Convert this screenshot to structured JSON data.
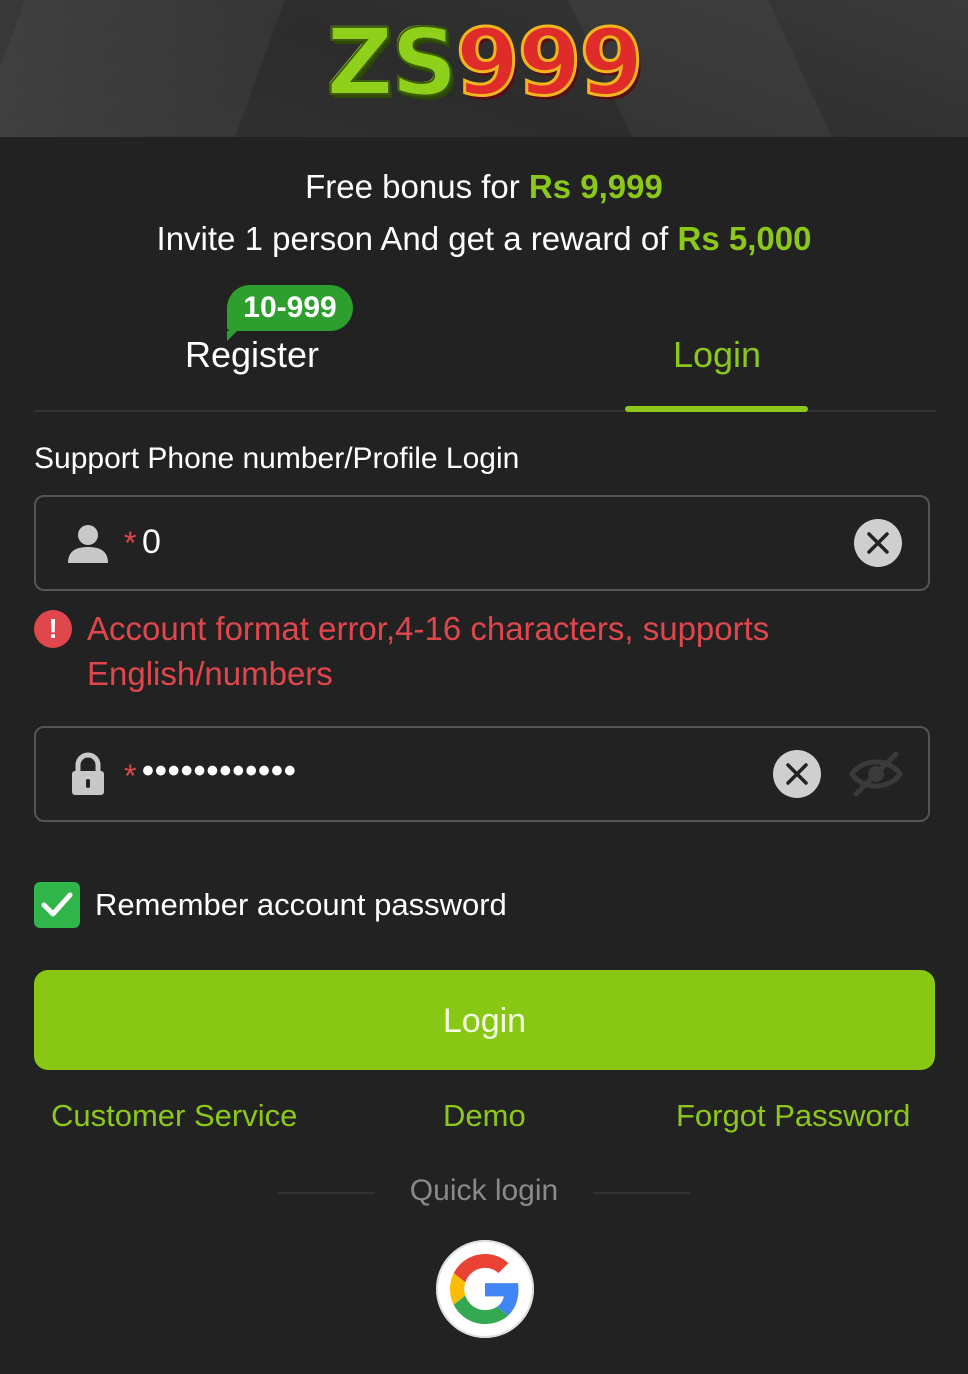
{
  "header": {
    "logo_part1": "ZS",
    "logo_part2": "999"
  },
  "promo": {
    "line1_prefix": "Free bonus for ",
    "line1_amount": "Rs 9,999",
    "line2_prefix": "Invite 1 person And get a reward of ",
    "line2_amount": "Rs 5,000"
  },
  "tabs": {
    "register_label": "Register",
    "register_badge": "10-999",
    "login_label": "Login",
    "active": "login"
  },
  "form": {
    "account_label": "Support Phone number/Profile Login",
    "account_required_mark": "*",
    "account_value": "0",
    "error_icon": "!",
    "error_message": "Account format error,4-16 characters, supports English/numbers",
    "password_required_mark": "*",
    "password_value": "••••••••••••",
    "remember_label": "Remember account password",
    "remember_checked": true,
    "login_button": "Login"
  },
  "links": {
    "customer_service": "Customer Service",
    "demo": "Demo",
    "forgot_password": "Forgot Password"
  },
  "quick_login": {
    "label": "Quick login",
    "providers": [
      "google-icon"
    ]
  },
  "colors": {
    "background": "#222222",
    "accent_green": "#8cc81a",
    "button_green": "#88c815",
    "error_red": "#e0474c",
    "checkbox_green": "#2fb54a",
    "badge_green": "#2e9f2e"
  }
}
